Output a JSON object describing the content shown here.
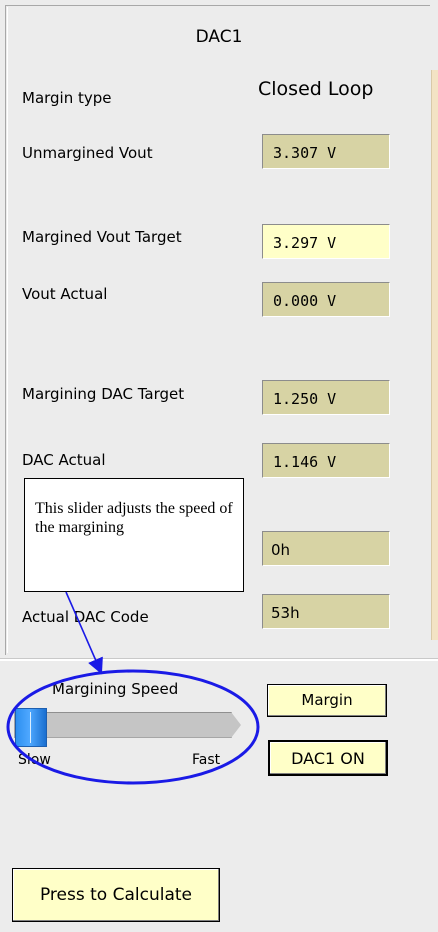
{
  "panel": {
    "title": "DAC1",
    "margin_type": {
      "label": "Margin type",
      "value": "Closed Loop"
    },
    "unmargined_vout": {
      "label": "Unmargined Vout",
      "value": "3.307 V"
    },
    "margined_vout_target": {
      "label": "Margined Vout Target",
      "value": "3.297 V"
    },
    "vout_actual": {
      "label": "Vout Actual",
      "value": "0.000 V"
    },
    "margining_dac_target": {
      "label": "Margining DAC Target",
      "value": "1.250 V"
    },
    "dac_actual": {
      "label": "DAC Actual",
      "value": "1.146 V"
    },
    "target_dac_code": {
      "value": "0h"
    },
    "actual_dac_code": {
      "label": "Actual DAC Code",
      "value": "53h"
    }
  },
  "callout": {
    "text": "This slider adjusts the speed of the margining"
  },
  "speed": {
    "label": "Margining Speed",
    "min_label": "Slow",
    "max_label": "Fast",
    "level": 0.0
  },
  "buttons": {
    "margin": "Margin",
    "dac1_on": "DAC1 ON",
    "calculate": "Press to Calculate"
  },
  "colors": {
    "readonly_field": "#d7d3a4",
    "input_field": "#ffffc8",
    "annotation": "#1a1ae6",
    "slider_thumb": "#2d8ff0"
  }
}
